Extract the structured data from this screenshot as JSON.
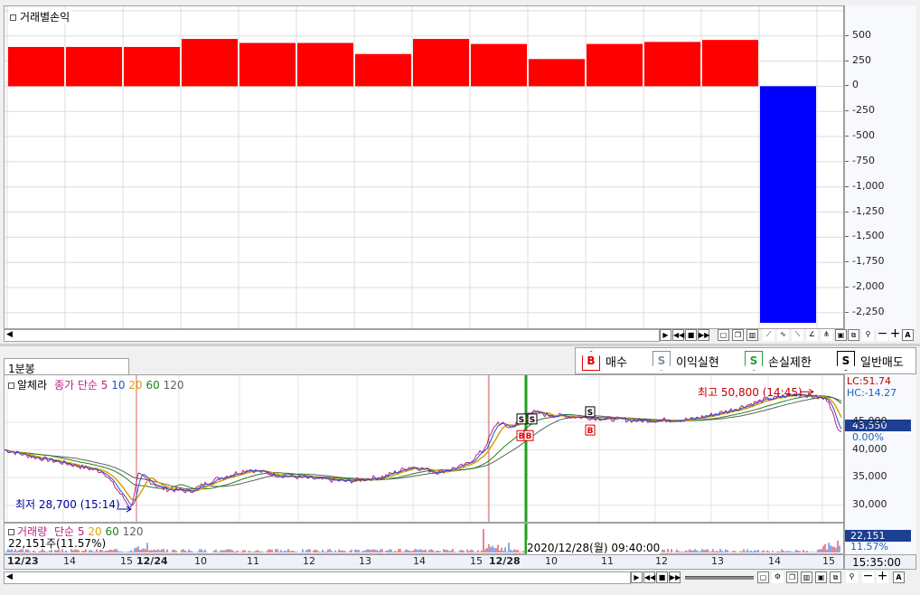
{
  "top_panel": {
    "title": "거래별손익",
    "bars": [
      390,
      390,
      390,
      470,
      430,
      430,
      320,
      470,
      420,
      270,
      420,
      440,
      460,
      -2350
    ],
    "positive_color": "#ff0000",
    "negative_color": "#0000ff",
    "y_ticks": [
      "500",
      "250",
      "0",
      "-250",
      "-500",
      "-750",
      "-1,000",
      "-1,250",
      "-1,500",
      "-1,750",
      "-2,000",
      "-2,250"
    ],
    "ylim": [
      -2350,
      650
    ]
  },
  "legend": {
    "buy": "매수",
    "buy_mark": "B",
    "profit": "이익실현",
    "profit_mark": "S",
    "loss": "손실제한",
    "loss_mark": "S",
    "normal": "일반매도",
    "normal_mark": "S"
  },
  "price_panel": {
    "tab_label": "1분봉",
    "indicator_prefix": "알체라",
    "ma_label": "종가 단순",
    "ma_periods": [
      "5",
      "10",
      "20",
      "60",
      "120"
    ],
    "ma_colors": [
      "#d01020",
      "#2050d0",
      "#e0a000",
      "#208020",
      "#606060"
    ],
    "y_ticks": [
      "45,000",
      "40,000",
      "35,000",
      "30,000"
    ],
    "lc": "LC:51.74",
    "hc": "HC:-14.27",
    "current_price": "43,550",
    "current_pct": "0.00%",
    "high_label": "최고 50,800 (14:45)",
    "low_label": "최저 28,700 (15:14)",
    "marker_labels": [
      "S",
      "S",
      "B",
      "B",
      "S",
      "B"
    ]
  },
  "volume_panel": {
    "label": "거래량",
    "ma_label": "단순",
    "ma_periods": [
      "5",
      "20",
      "60",
      "120"
    ],
    "ma_colors": [
      "#d01020",
      "#e0a000",
      "#208020",
      "#606060"
    ],
    "info": "22,151주(11.57%)",
    "current": "22,151",
    "current_pct": "11.57%",
    "cursor_label": "2020/12/28(월) 09:40:00"
  },
  "time_axis": {
    "labels": [
      "12/23",
      "14",
      "15",
      "12/24",
      "10",
      "11",
      "12",
      "13",
      "14",
      "15",
      "12/28",
      "10",
      "11",
      "12",
      "13",
      "14",
      "15"
    ],
    "bold": [
      "12/23",
      "12/24",
      "12/28"
    ],
    "time_box": "15:35:00"
  }
}
